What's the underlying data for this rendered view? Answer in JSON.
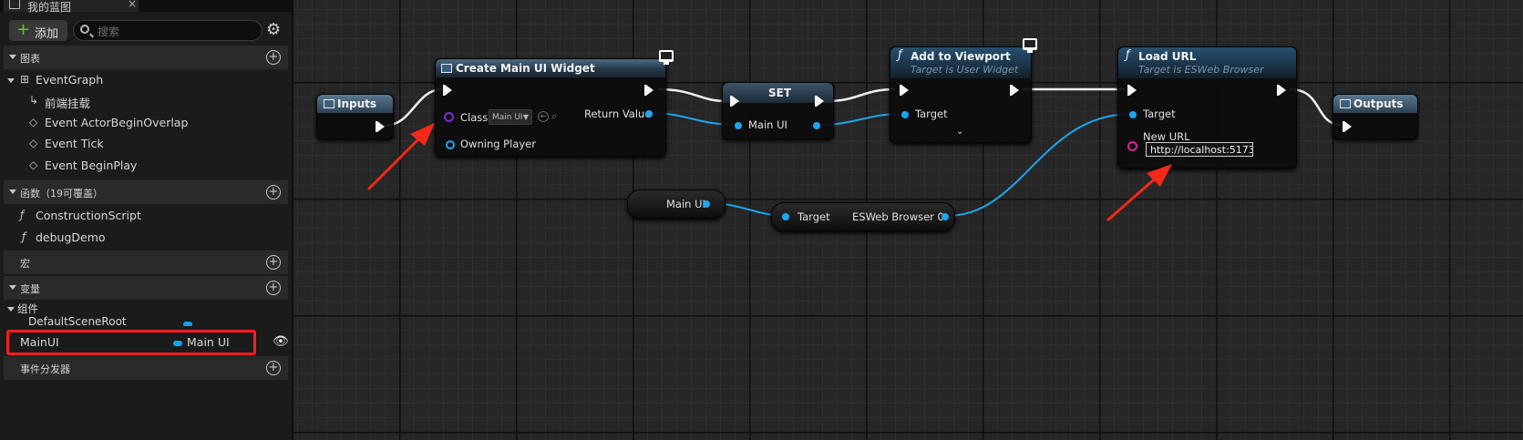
{
  "tab": {
    "title": "我的蓝图",
    "close": "×"
  },
  "toolbar": {
    "add_label": "添加",
    "search_placeholder": "搜索",
    "settings_icon": "gear-icon"
  },
  "sections": {
    "graphs": "图表",
    "functions": "函数（19可覆盖）",
    "macros": "宏",
    "variables": "变量",
    "components": "组件",
    "dispatchers": "事件分发器"
  },
  "graph_items": [
    "EventGraph",
    "前端挂载",
    "Event ActorBeginOverlap",
    "Event Tick",
    "Event BeginPlay"
  ],
  "function_items": [
    "ConstructionScript",
    "debugDemo"
  ],
  "component_items": [
    "DefaultSceneRoot"
  ],
  "variable": {
    "name": "MainUI",
    "type": "Main UI"
  },
  "nodes": {
    "inputs": "Inputs",
    "create_widget": {
      "title": "Create Main UI Widget",
      "class_label": "Class",
      "class_value": "Main UI",
      "owning": "Owning Player",
      "return": "Return Value"
    },
    "set": {
      "title": "SET",
      "pin": "Main UI"
    },
    "add_viewport": {
      "title": "Add to Viewport",
      "subtitle": "Target is User Widget",
      "target": "Target"
    },
    "load_url": {
      "title": "Load URL",
      "subtitle": "Target is ESWeb Browser",
      "target": "Target",
      "new_url": "New URL",
      "url_value": "http://localhost:5173"
    },
    "outputs": "Outputs",
    "get_mainui": "Main UI",
    "esweb": {
      "target": "Target",
      "out": "ESWeb Browser 0"
    }
  },
  "colors": {
    "object_pin": "#1ea6f0",
    "class_pin": "#7b2fd0",
    "string_pin": "#e0209e",
    "highlight": "#ff1e1e",
    "add_plus": "#6fc03c"
  }
}
